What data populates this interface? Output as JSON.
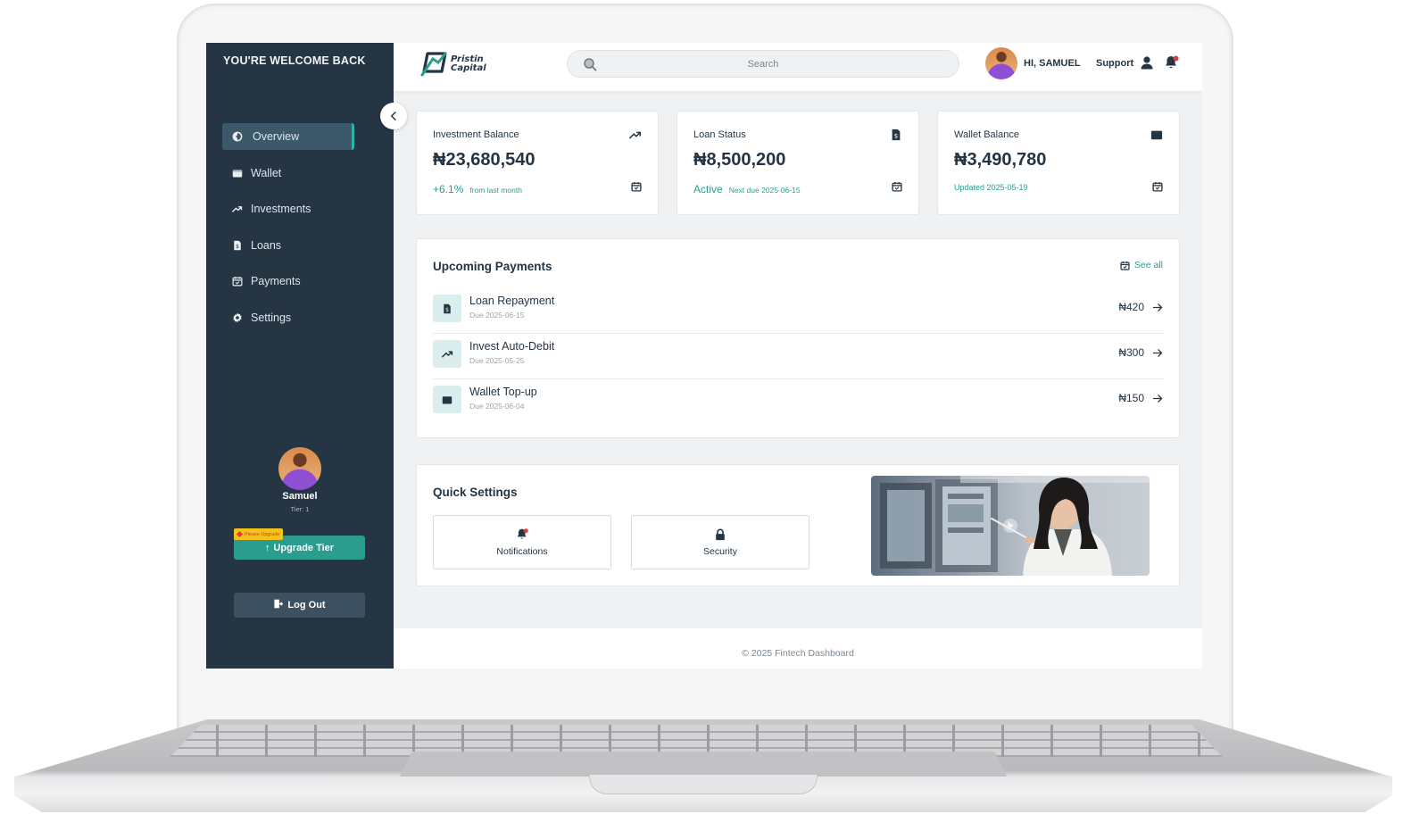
{
  "colors": {
    "sidebar_bg": "#253544",
    "accent": "#2a9d8f",
    "content_bg": "#eff1f3",
    "card_bg": "#ffffff"
  },
  "sidebar": {
    "welcome": "YOU'RE WELCOME BACK",
    "nav": [
      {
        "label": "Overview",
        "icon": "overview-icon",
        "active": true
      },
      {
        "label": "Wallet",
        "icon": "wallet-icon",
        "active": false
      },
      {
        "label": "Investments",
        "icon": "trending-up-icon",
        "active": false
      },
      {
        "label": "Loans",
        "icon": "loan-document-icon",
        "active": false
      },
      {
        "label": "Payments",
        "icon": "calendar-check-icon",
        "active": false
      },
      {
        "label": "Settings",
        "icon": "gear-icon",
        "active": false
      }
    ],
    "profile": {
      "name": "Samuel",
      "tier": "Tier: 1"
    },
    "please_upgrade": "Please Upgrade",
    "upgrade_label": "Upgrade Tier",
    "logout_label": "Log Out"
  },
  "topbar": {
    "logo_line1": "Pristin",
    "logo_line2": "Capital",
    "search_placeholder": "Search",
    "greeting": "HI, SAMUEL",
    "support": "Support"
  },
  "stats": [
    {
      "title": "Investment Balance",
      "icon": "trending-up-icon",
      "value": "₦23,680,540",
      "foot_main": "+6.1%",
      "foot_sub": "from last month"
    },
    {
      "title": "Loan Status",
      "icon": "loan-document-icon",
      "value": "₦8,500,200",
      "foot_main": "Active",
      "foot_sub": "Next due 2025-06-15"
    },
    {
      "title": "Wallet Balance",
      "icon": "wallet-icon",
      "value": "₦3,490,780",
      "foot_main": "",
      "foot_sub": "Updated 2025-05-19"
    }
  ],
  "upcoming": {
    "title": "Upcoming Payments",
    "see_all": "See all",
    "items": [
      {
        "name": "Loan Repayment",
        "due": "Due 2025-06-15",
        "amount": "₦420",
        "icon": "loan-document-icon"
      },
      {
        "name": "Invest Auto-Debit",
        "due": "Due 2025-05-25",
        "amount": "₦300",
        "icon": "trending-up-icon"
      },
      {
        "name": "Wallet Top-up",
        "due": "Due 2025-06-04",
        "amount": "₦150",
        "icon": "wallet-icon"
      }
    ]
  },
  "quick_settings": {
    "title": "Quick Settings",
    "buttons": [
      {
        "label": "Notifications",
        "icon": "bell-icon"
      },
      {
        "label": "Security",
        "icon": "lock-icon"
      }
    ]
  },
  "footer": "© 2025 Fintech Dashboard"
}
